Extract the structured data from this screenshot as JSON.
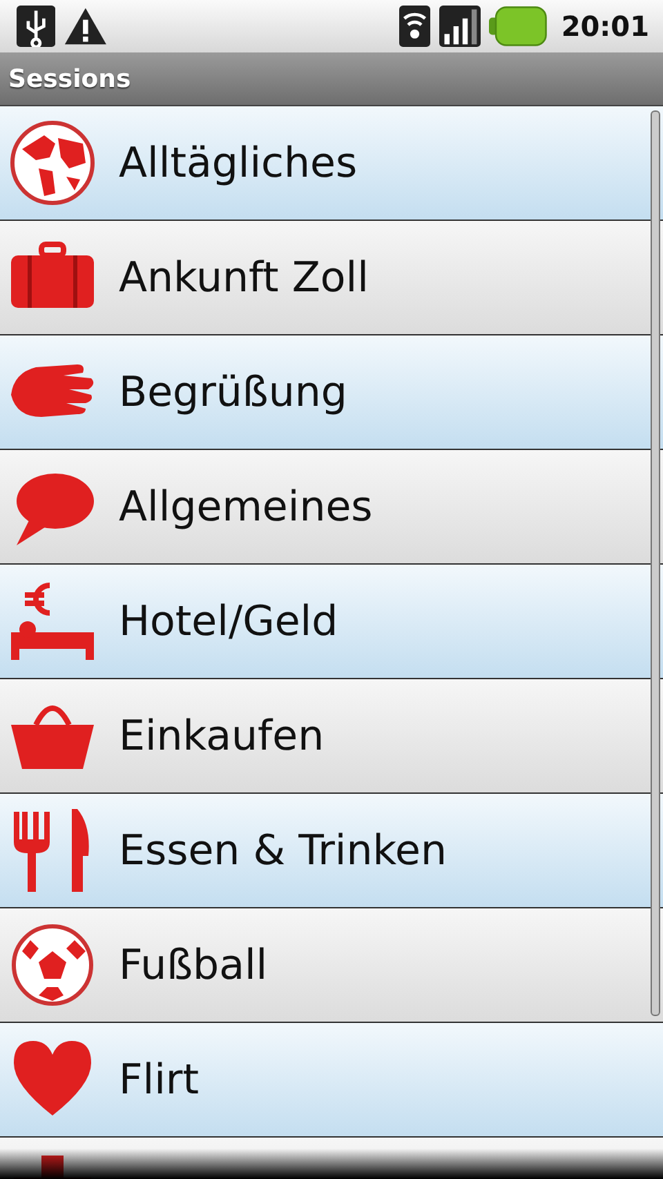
{
  "status_bar": {
    "time": "20:01"
  },
  "title_bar": {
    "title": "Sessions"
  },
  "sessions": [
    {
      "kind": "globe",
      "label": "Alltägliches"
    },
    {
      "kind": "suitcase",
      "label": "Ankunft Zoll"
    },
    {
      "kind": "hand",
      "label": "Begrüßung"
    },
    {
      "kind": "speech",
      "label": "Allgemeines"
    },
    {
      "kind": "bed",
      "label": "Hotel/Geld"
    },
    {
      "kind": "basket",
      "label": "Einkaufen"
    },
    {
      "kind": "cutlery",
      "label": "Essen & Trinken"
    },
    {
      "kind": "ball",
      "label": "Fußball"
    },
    {
      "kind": "heart",
      "label": "Flirt"
    },
    {
      "kind": "cross"
    }
  ]
}
